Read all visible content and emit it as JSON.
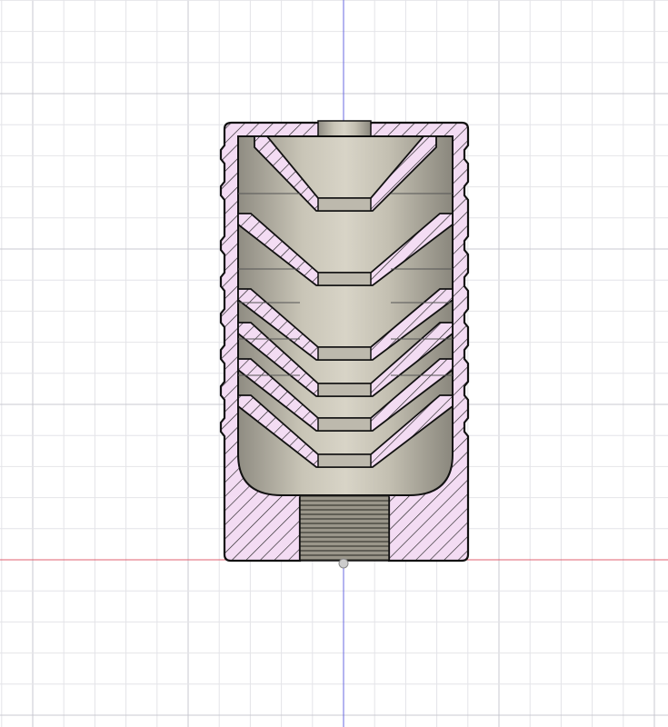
{
  "viewport": {
    "view": "section-view",
    "colors": {
      "background": "#ffffff",
      "grid_minor": "#e4e4e8",
      "grid_major": "#c9c9d0",
      "x_axis": "#e06070",
      "z_axis": "#6a6ae0",
      "section_hatch_fill": "#f3dcf3",
      "section_hatch_line": "#1a1a1a",
      "cavity_surface": "#b9b5a8"
    },
    "icons": [
      "origin-point-icon"
    ]
  }
}
